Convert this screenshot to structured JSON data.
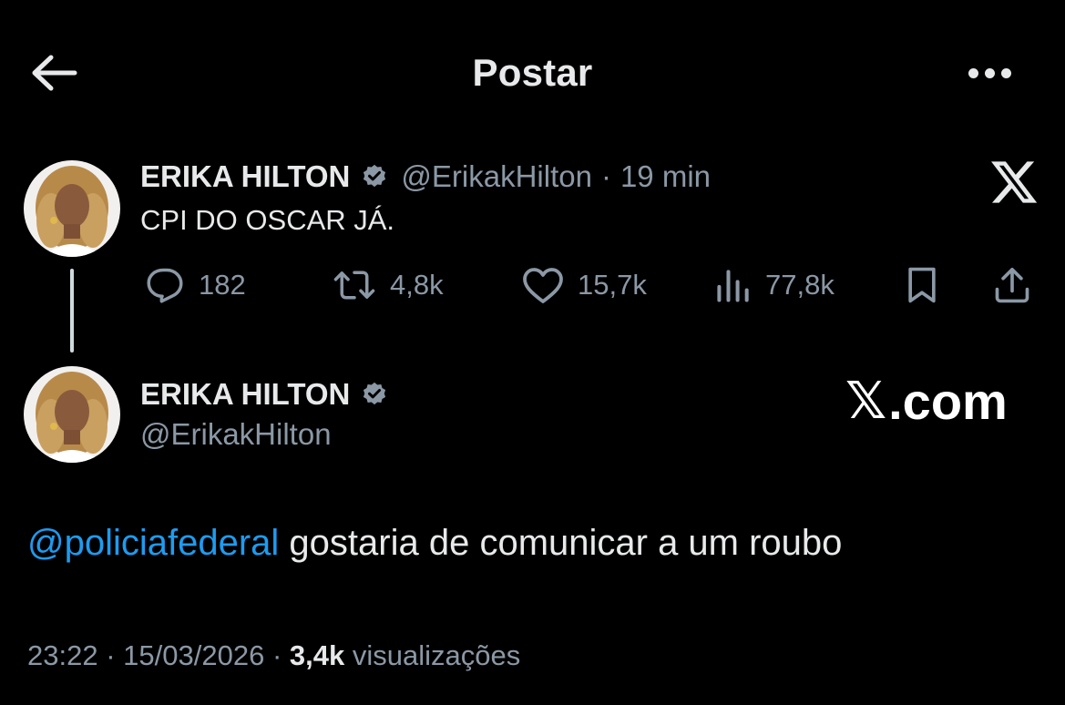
{
  "header": {
    "title": "Postar"
  },
  "quoted_tweet": {
    "author_name": "ERIKA HILTON",
    "handle": "@ErikakHilton",
    "separator": "·",
    "time": "19 min",
    "text": "CPI DO OSCAR JÁ.",
    "actions": {
      "replies": "182",
      "reposts": "4,8k",
      "likes": "15,7k",
      "views": "77,8k"
    }
  },
  "main_tweet": {
    "author_name": "ERIKA HILTON",
    "handle": "@ErikakHilton",
    "mention": "@policiafederal",
    "text": " gostaria de comunicar a um roubo",
    "time": "23:22",
    "date": "15/03/2026",
    "separator": "·",
    "views_count": "3,4k",
    "views_label": "visualizações"
  },
  "watermark": {
    "logo_glyph": "𝕏",
    "domain": ".com"
  },
  "colors": {
    "background": "#000000",
    "text_primary": "#e7e9ea",
    "text_secondary": "#8b98a5",
    "link": "#1d9bf0",
    "verified_badge": "#8b98a5"
  },
  "icons": [
    "back-arrow-icon",
    "more-icon",
    "verified-icon",
    "x-logo-icon",
    "reply-icon",
    "repost-icon",
    "like-icon",
    "views-icon",
    "bookmark-icon",
    "share-icon"
  ]
}
